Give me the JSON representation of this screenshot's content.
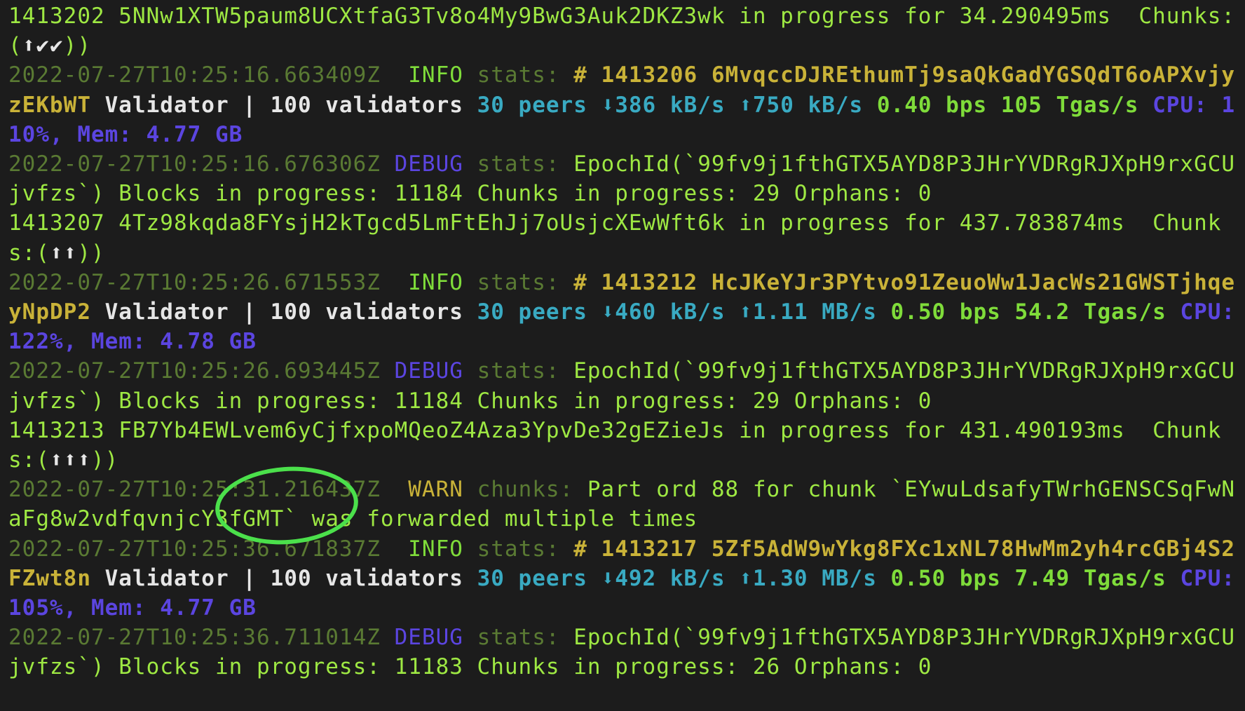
{
  "lines": {
    "l0": {
      "text": "1413202 5NNw1XTW5paum8UCXtfaG3Tv8o4My9BwG3Auk2DKZ3wk in progress for 34.290495ms  Chunks:(",
      "icons": "⬆✔✔",
      "tail": "))"
    },
    "l1": {
      "ts": "2022-07-27T10:25:16.663409Z",
      "level": "  INFO ",
      "target": "stats:",
      "head": " # 1413206 6MvqccDJREthumTj9saQkGadYGSQdT6oAPXvjyzEKbWT",
      "role": " Validator",
      "validators": " | 100 validators",
      "peers": " 30 peers",
      "down_icon": "⬇",
      "down": "386 kB/s",
      "up_icon": "⬆",
      "up": "750 kB/s",
      "bps": " 0.40 bps 105 Tgas/s",
      "cpu": " CPU: 110%, Mem: 4.77 GB"
    },
    "l2": {
      "ts": "2022-07-27T10:25:16.676306Z",
      "level": " DEBUG ",
      "target": "stats:",
      "text": " EpochId(`99fv9j1fthGTX5AYD8P3JHrYVDRgRJXpH9rxGCUjvfzs`) Blocks in progress: 11184 Chunks in progress: 29 Orphans: 0"
    },
    "l3": {
      "text": "1413207 4Tz98kqda8FYsjH2kTgcd5LmFtEhJj7oUsjcXEwWft6k in progress for 437.783874ms  Chunks:(",
      "icons": "⬆⬆",
      "tail": "))"
    },
    "l4": {
      "ts": "2022-07-27T10:25:26.671553Z",
      "level": "  INFO ",
      "target": "stats:",
      "head": " # 1413212 HcJKeYJr3PYtvo91ZeuoWw1JacWs21GWSTjhqeyNpDP2",
      "role": " Validator",
      "validators": " | 100 validators",
      "peers": " 30 peers",
      "down_icon": "⬇",
      "down": "460 kB/s",
      "up_icon": "⬆",
      "up": "1.11 MB/s",
      "bps": " 0.50 bps 54.2 Tgas/s",
      "cpu": " CPU: 122%, Mem: 4.78 GB"
    },
    "l5": {
      "ts": "2022-07-27T10:25:26.693445Z",
      "level": " DEBUG ",
      "target": "stats:",
      "text": " EpochId(`99fv9j1fthGTX5AYD8P3JHrYVDRgRJXpH9rxGCUjvfzs`) Blocks in progress: 11184 Chunks in progress: 29 Orphans: 0"
    },
    "l6": {
      "text": "1413213 FB7Yb4EWLvem6yCjfxpoMQeoZ4Aza3YpvDe32gEZieJs in progress for 431.490193ms  Chunks:(",
      "icons": "⬆⬆⬆",
      "tail": "))"
    },
    "l7": {
      "ts": "2022-07-27T10:25:31.216437Z",
      "level": "  WARN ",
      "target": "chunks:",
      "text": " Part ord 88 for chunk `EYwuLdsafyTWrhGENSCSqFwNaFg8w2vdfqvnjcY3fGMT` was forwarded multiple times"
    },
    "l8": {
      "ts": "2022-07-27T10:25:36.671837Z",
      "level": "  INFO ",
      "target": "stats:",
      "head": " # 1413217 5Zf5AdW9wYkg8FXc1xNL78HwMm2yh4rcGBj4S2FZwt8n",
      "role": " Validator",
      "validators": " | 100 validators",
      "peers": " 30 peers",
      "down_icon": "⬇",
      "down": "492 kB/s",
      "up_icon": "⬆",
      "up": "1.30 MB/s",
      "bps": " 0.50 bps 7.49 Tgas/s",
      "cpu": " CPU: 105%, Mem: 4.77 GB"
    },
    "l9": {
      "ts": "2022-07-27T10:25:36.711014Z",
      "level": " DEBUG ",
      "target": "stats:",
      "text": " EpochId(`99fv9j1fthGTX5AYD8P3JHrYVDRgRJXpH9rxGCUjvfzs`) Blocks in progress: 11183 Chunks in progress: 26 Orphans: 0"
    }
  },
  "colors": {
    "background": "#1c1c1c",
    "log_green": "#9ee843",
    "timestamp": "#5a7a33",
    "debug": "#5b45e0",
    "warn": "#c9b238",
    "cyan": "#39aac2",
    "annotation_circle": "#4be04b"
  }
}
